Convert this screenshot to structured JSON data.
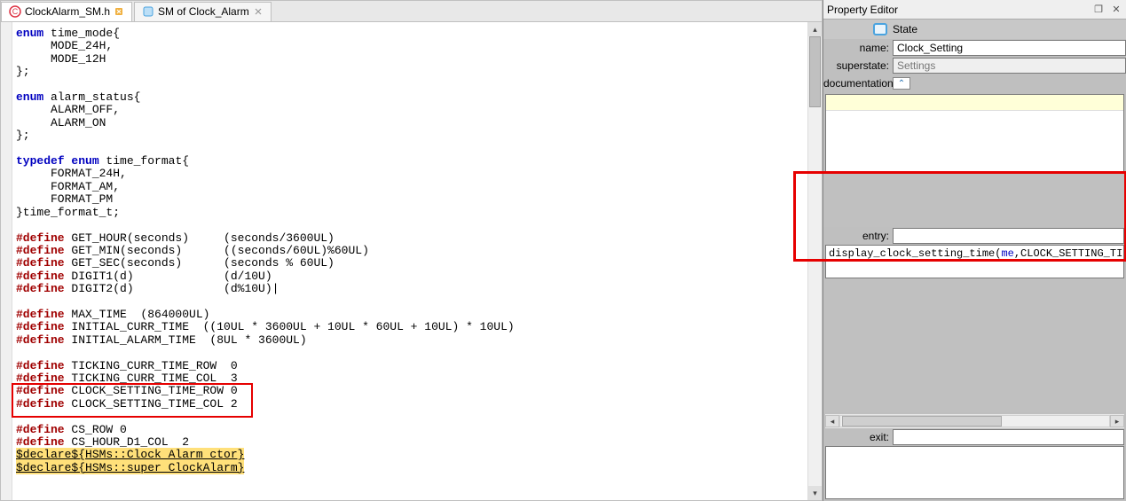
{
  "tabs": [
    {
      "label": "ClockAlarm_SM.h",
      "icon": "c-file",
      "active": true,
      "closed_icon": "orange"
    },
    {
      "label": "SM of Clock_Alarm",
      "icon": "sm-file",
      "active": false,
      "closed_icon": "gray"
    }
  ],
  "code": {
    "lines": [
      {
        "t": "enum",
        "rest": " time_mode{"
      },
      {
        "indent": "     ",
        "plain": "MODE_24H,"
      },
      {
        "indent": "     ",
        "plain": "MODE_12H"
      },
      {
        "plain": "};"
      },
      {
        "plain": ""
      },
      {
        "t": "enum",
        "rest": " alarm_status{"
      },
      {
        "indent": "     ",
        "plain": "ALARM_OFF,"
      },
      {
        "indent": "     ",
        "plain": "ALARM_ON"
      },
      {
        "plain": "};"
      },
      {
        "plain": ""
      },
      {
        "t": "typedef enum",
        "rest": " time_format{"
      },
      {
        "indent": "     ",
        "plain": "FORMAT_24H,"
      },
      {
        "indent": "     ",
        "plain": "FORMAT_AM,"
      },
      {
        "indent": "     ",
        "plain": "FORMAT_PM"
      },
      {
        "plain": "}time_format_t;"
      },
      {
        "plain": ""
      },
      {
        "pp": "#define",
        "rest": " GET_HOUR(seconds)     (seconds/3600UL)"
      },
      {
        "pp": "#define",
        "rest": " GET_MIN(seconds)      ((seconds/60UL)%60UL)"
      },
      {
        "pp": "#define",
        "rest": " GET_SEC(seconds)      (seconds % 60UL)"
      },
      {
        "pp": "#define",
        "rest": " DIGIT1(d)             (d/10U)"
      },
      {
        "pp": "#define",
        "rest": " DIGIT2(d)             (d%10U)|"
      },
      {
        "plain": ""
      },
      {
        "pp": "#define",
        "rest": " MAX_TIME  (864000UL)"
      },
      {
        "pp": "#define",
        "rest": " INITIAL_CURR_TIME  ((10UL * 3600UL + 10UL * 60UL + 10UL) * 10UL)"
      },
      {
        "pp": "#define",
        "rest": " INITIAL_ALARM_TIME  (8UL * 3600UL)"
      },
      {
        "plain": ""
      },
      {
        "pp": "#define",
        "rest": " TICKING_CURR_TIME_ROW  0"
      },
      {
        "pp": "#define",
        "rest": " TICKING_CURR_TIME_COL  3"
      },
      {
        "pp": "#define",
        "rest": " CLOCK_SETTING_TIME_ROW 0"
      },
      {
        "pp": "#define",
        "rest": " CLOCK_SETTING_TIME_COL 2"
      },
      {
        "plain": ""
      },
      {
        "pp": "#define",
        "rest": " CS_ROW 0"
      },
      {
        "pp": "#define",
        "rest": " CS_HOUR_D1_COL  2"
      },
      {
        "declare": "$declare${HSMs::Clock_Alarm_ctor}"
      },
      {
        "declare": "$declare${HSMs::super_ClockAlarm}"
      }
    ]
  },
  "highlight_left": {
    "top_line": 28,
    "height_lines": 2
  },
  "propertyEditor": {
    "title": "Property Editor",
    "stateLabel": "State",
    "fields": {
      "name_label": "name:",
      "name_value": "Clock_Setting",
      "superstate_label": "superstate:",
      "superstate_value": "Settings",
      "documentation_label": "documentation:",
      "entry_label": "entry:",
      "entry_text_pre": "display_clock_setting_time(",
      "entry_text_me": "me",
      "entry_text_post": ",CLOCK_SETTING_TIME_ROW",
      "exit_label": "exit:"
    }
  }
}
